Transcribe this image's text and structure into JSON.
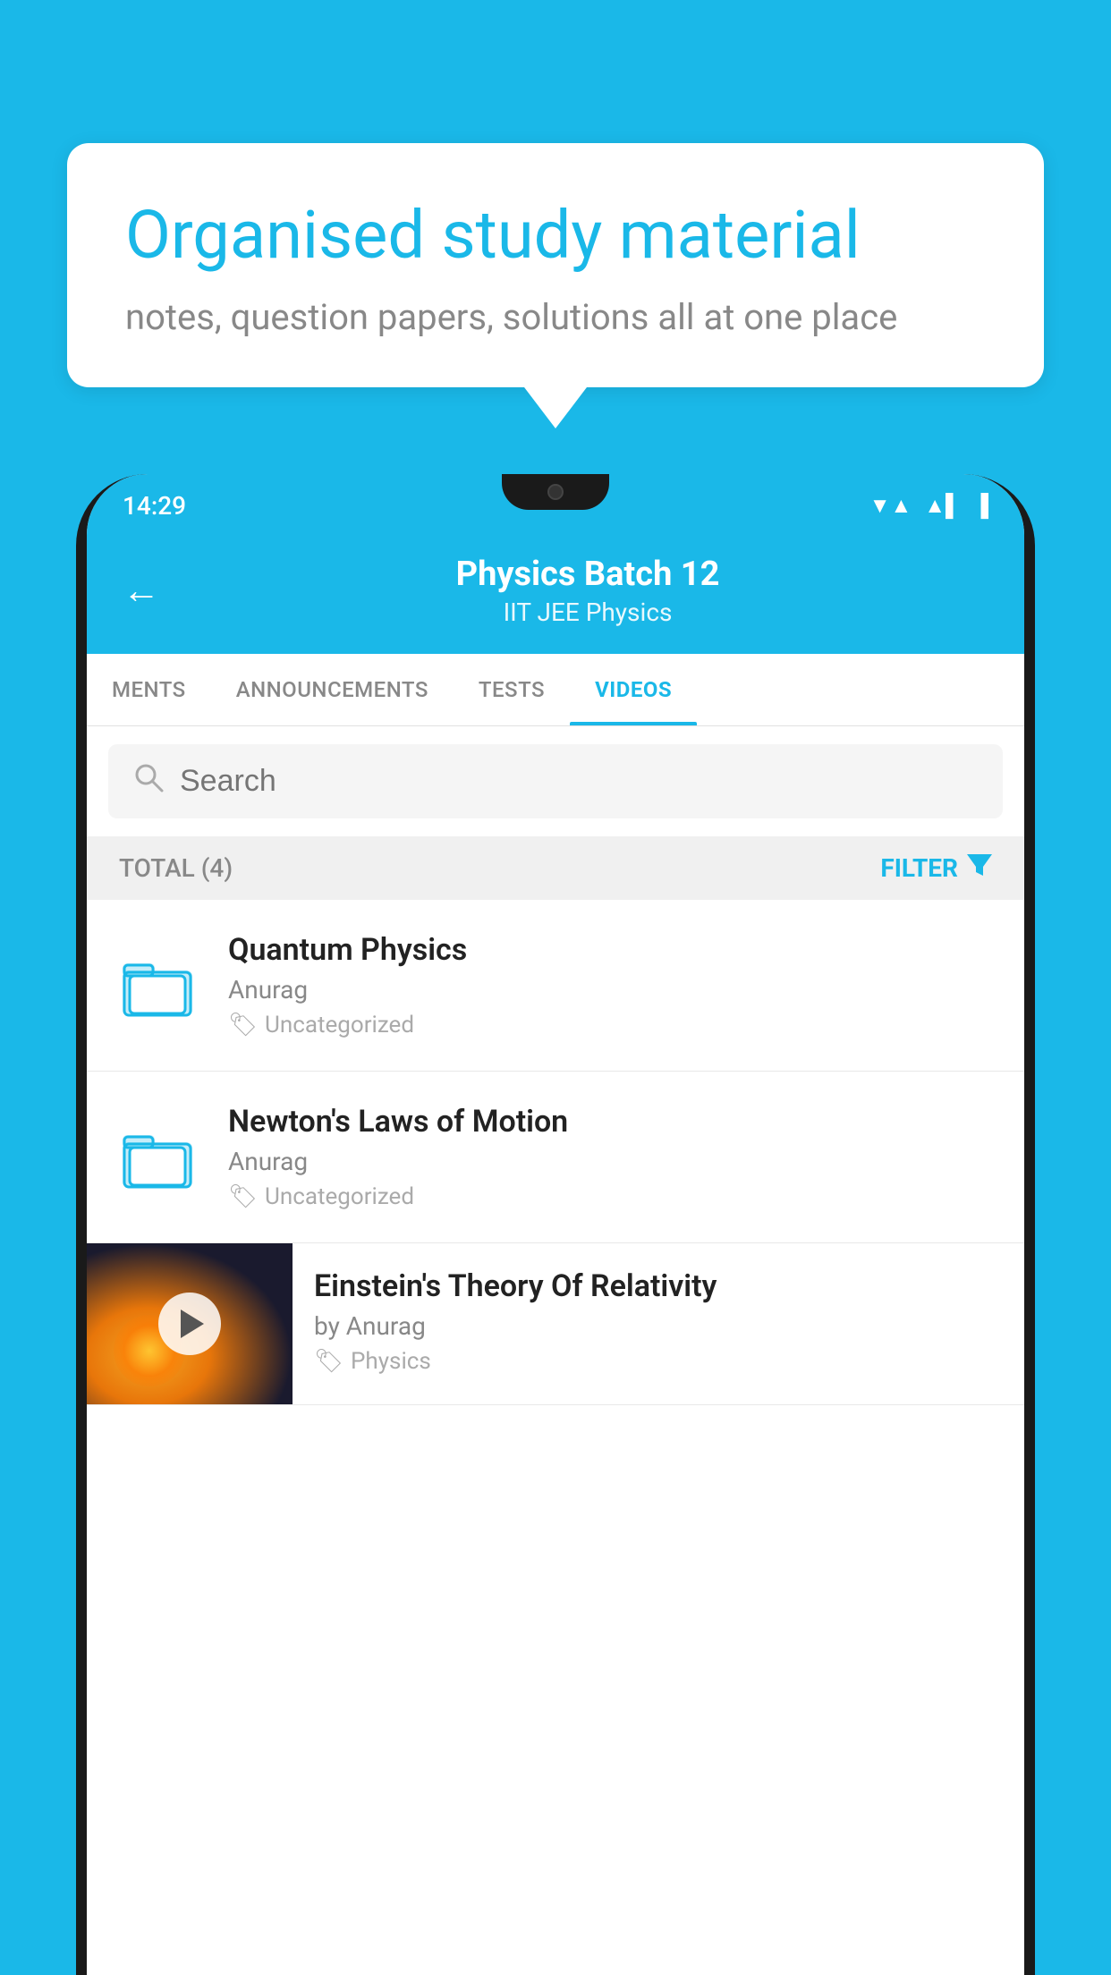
{
  "background_color": "#1ab8e8",
  "speech_bubble": {
    "heading": "Organised study material",
    "subtext": "notes, question papers, solutions all at one place"
  },
  "phone": {
    "status_bar": {
      "time": "14:29",
      "icons": [
        "wifi",
        "signal",
        "battery"
      ]
    },
    "app_bar": {
      "back_label": "←",
      "title": "Physics Batch 12",
      "subtitle": "IIT JEE   Physics"
    },
    "tabs": [
      {
        "label": "MENTS",
        "active": false
      },
      {
        "label": "ANNOUNCEMENTS",
        "active": false
      },
      {
        "label": "TESTS",
        "active": false
      },
      {
        "label": "VIDEOS",
        "active": true
      }
    ],
    "search": {
      "placeholder": "Search"
    },
    "filter_row": {
      "total_label": "TOTAL (4)",
      "filter_label": "FILTER"
    },
    "videos": [
      {
        "id": 1,
        "title": "Quantum Physics",
        "author": "Anurag",
        "tag": "Uncategorized",
        "type": "folder"
      },
      {
        "id": 2,
        "title": "Newton's Laws of Motion",
        "author": "Anurag",
        "tag": "Uncategorized",
        "type": "folder"
      },
      {
        "id": 3,
        "title": "Einstein's Theory Of Relativity",
        "author": "by Anurag",
        "tag": "Physics",
        "type": "video"
      }
    ]
  }
}
